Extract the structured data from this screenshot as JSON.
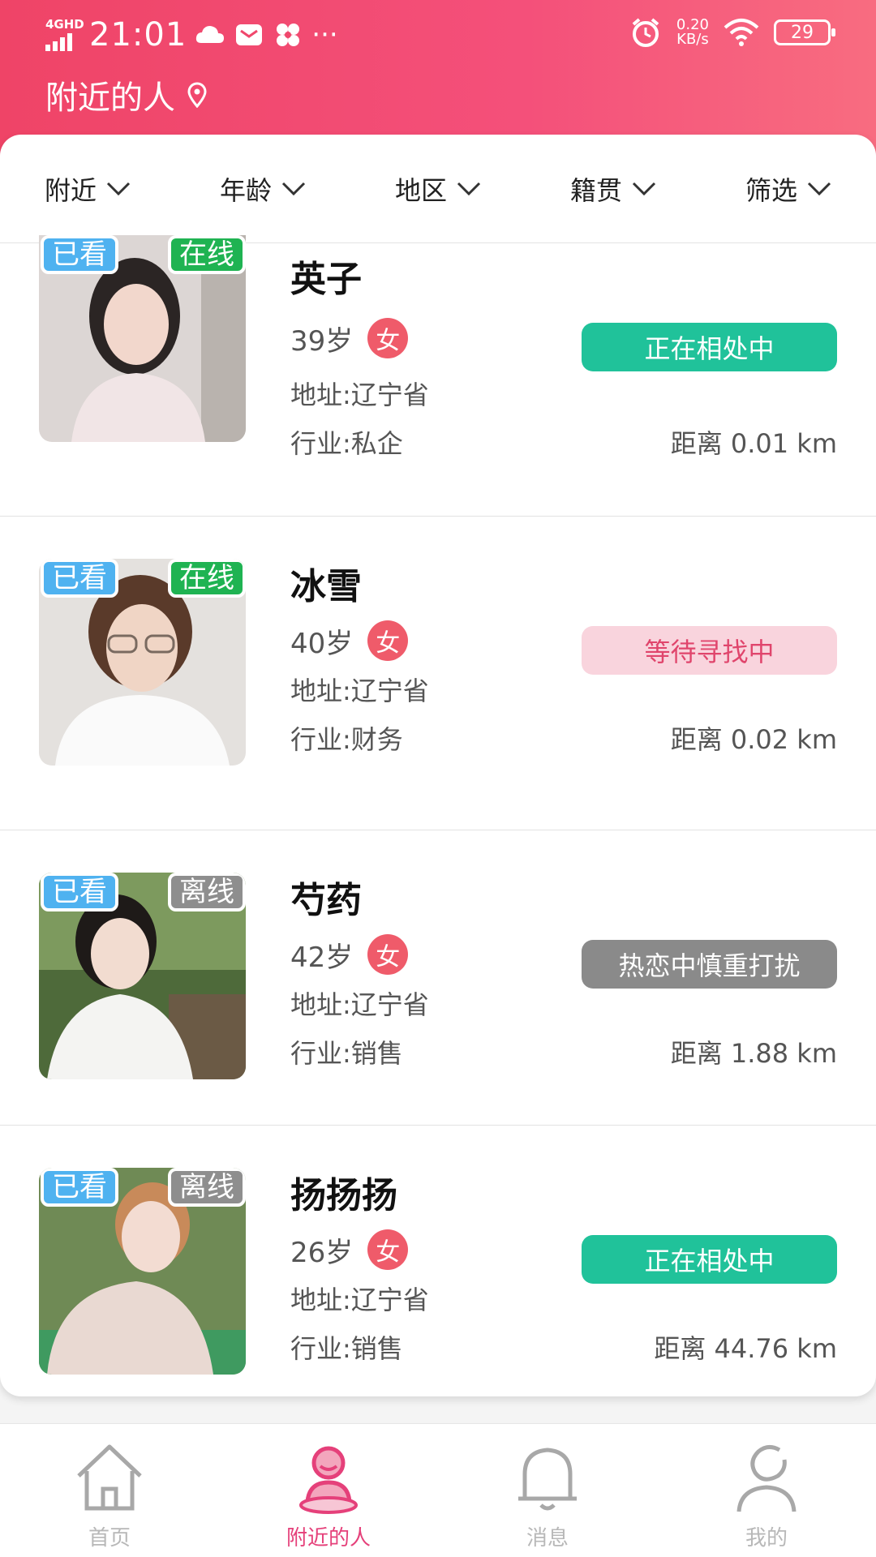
{
  "status_bar": {
    "network": "4GHD",
    "time": "21:01",
    "more": "···",
    "speed_value": "0.20",
    "speed_unit": "KB/s",
    "battery": "29"
  },
  "header": {
    "title": "附近的人"
  },
  "filters": [
    {
      "label": "附近"
    },
    {
      "label": "年龄"
    },
    {
      "label": "地区"
    },
    {
      "label": "籍贯"
    },
    {
      "label": "筛选"
    }
  ],
  "people": [
    {
      "seen": "已看",
      "presence": "在线",
      "name": "英子",
      "age": "39岁",
      "gender": "女",
      "address": "地址:辽宁省",
      "industry": "行业:私企",
      "status": "正在相处中",
      "distance": "距离 0.01 km"
    },
    {
      "seen": "已看",
      "presence": "在线",
      "name": "冰雪",
      "age": "40岁",
      "gender": "女",
      "address": "地址:辽宁省",
      "industry": "行业:财务",
      "status": "等待寻找中",
      "distance": "距离 0.02 km"
    },
    {
      "seen": "已看",
      "presence": "离线",
      "name": "芍药",
      "age": "42岁",
      "gender": "女",
      "address": "地址:辽宁省",
      "industry": "行业:销售",
      "status": "热恋中慎重打扰",
      "distance": "距离 1.88 km"
    },
    {
      "seen": "已看",
      "presence": "离线",
      "name": "扬扬扬",
      "age": "26岁",
      "gender": "女",
      "address": "地址:辽宁省",
      "industry": "行业:销售",
      "status": "正在相处中",
      "distance": "距离 44.76 km"
    }
  ],
  "tabbar": [
    {
      "label": "首页",
      "icon": "home-icon"
    },
    {
      "label": "附近的人",
      "icon": "nearby-person-icon",
      "active": true
    },
    {
      "label": "消息",
      "icon": "bell-icon"
    },
    {
      "label": "我的",
      "icon": "profile-icon"
    }
  ],
  "colors": {
    "header_start": "#ef4467",
    "header_end": "#f86c80",
    "status_green": "#20c29a",
    "status_pink_bg": "#f9d4dd",
    "status_pink_text": "#e0456c",
    "status_gray": "#8a8a8a",
    "online_green": "#1fb352",
    "offline_gray": "#8e8e8e",
    "seen_blue": "#4fb2f0",
    "active_tab": "#e5407a"
  }
}
